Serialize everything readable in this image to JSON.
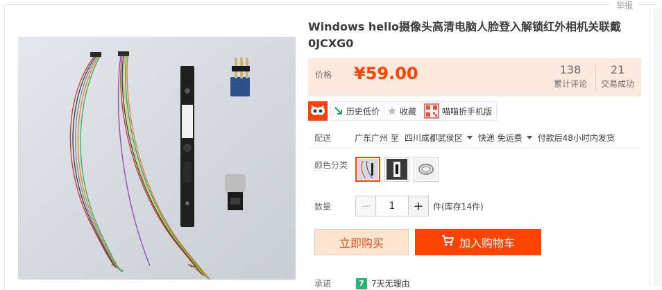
{
  "report_label": "举报",
  "product": {
    "title": "Windows hello摄像头高清电脑人脸登入解锁红外相机关联戴0JCXG0"
  },
  "price": {
    "label": "价格",
    "value": "¥59.00"
  },
  "stats": {
    "reviews_count": "138",
    "reviews_label": "累计评论",
    "sold_count": "21",
    "sold_label": "交易成功"
  },
  "tools": {
    "history_label": "历史低价",
    "favorite_label": "收藏",
    "mobile_label": "喵喵折手机版"
  },
  "shipping": {
    "label": "配送",
    "from": "广东广州 至",
    "to": "四川成都武侯区",
    "method": "快递 免运费",
    "note": "付款后48小时内发货"
  },
  "color_option": {
    "label": "颜色分类",
    "swatch_count": 3,
    "selected_index": 0
  },
  "quantity": {
    "label": "数量",
    "minus": "−",
    "value": "1",
    "plus": "+",
    "stock": "件(库存14件)"
  },
  "actions": {
    "buy_now": "立即购买",
    "add_to_cart": "加入购物车"
  },
  "promise": {
    "label": "承诺",
    "badge": "7",
    "text": "7天无理由"
  },
  "colors": {
    "accent": "#ff4400",
    "price_bg": "#fde8dc",
    "buy_bg": "#ffe4d0"
  }
}
